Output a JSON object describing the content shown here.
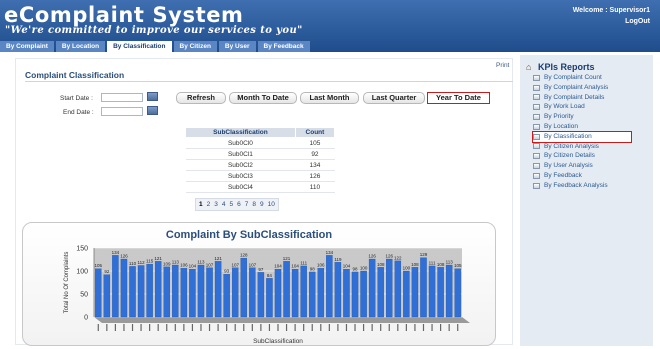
{
  "header": {
    "title": "eComplaint System",
    "tagline": "\"We're committed to improve our services to you\"",
    "welcome": "Welcome : Supervisor1",
    "logout": "LogOut",
    "tabs": [
      "By Complaint",
      "By Location",
      "By Classification",
      "By Citizen",
      "By User",
      "By Feedback"
    ],
    "active_tab": "By Classification"
  },
  "main": {
    "print": "Print",
    "section_title": "Complaint Classification",
    "start_date_label": "Start Date :",
    "end_date_label": "End Date :",
    "start_date_value": "",
    "end_date_value": "",
    "buttons": {
      "refresh": "Refresh",
      "month_to_date": "Month To Date",
      "last_month": "Last Month",
      "last_quarter": "Last Quarter",
      "year_to_date": "Year To Date"
    },
    "table": {
      "headers": [
        "SubClassification",
        "Count"
      ],
      "rows": [
        [
          "Sub0Cl0",
          "105"
        ],
        [
          "Sub0Cl1",
          "92"
        ],
        [
          "Sub0Cl2",
          "134"
        ],
        [
          "Sub0Cl3",
          "126"
        ],
        [
          "Sub0Cl4",
          "110"
        ]
      ]
    },
    "pager": [
      "1",
      "2",
      "3",
      "4",
      "5",
      "6",
      "7",
      "8",
      "9",
      "10"
    ],
    "pager_current": "1"
  },
  "chart_data": {
    "type": "bar",
    "title": "Complaint By SubClassification",
    "xlabel": "SubClassification",
    "ylabel": "Total No Of Complaints",
    "ylim": [
      0,
      150
    ],
    "yticks": [
      0,
      50,
      100,
      150
    ],
    "grid": true,
    "bar_color": "#2f6fd6",
    "values": [
      105,
      92,
      134,
      126,
      110,
      112,
      115,
      121,
      109,
      113,
      106,
      104,
      113,
      107,
      121,
      93,
      107,
      128,
      107,
      97,
      84,
      104,
      121,
      104,
      111,
      98,
      106,
      134,
      119,
      104,
      98,
      100,
      126,
      108,
      126,
      122,
      100,
      108,
      129,
      111,
      108,
      113,
      105
    ]
  },
  "sidebar": {
    "title": "KPIs Reports",
    "items": [
      "By Complaint Count",
      "By Complaint Analysis",
      "By Complaint Details",
      "By Work Load",
      "By Priority",
      "By Location",
      "By Classification",
      "By Citizen Analysis",
      "By Citizen Details",
      "By User Analysis",
      "By Feedback",
      "By Feedback Analysis"
    ],
    "active_item": "By Classification"
  },
  "colors": {
    "header_bg": "#2b5a9a",
    "accent_red": "#cc1a1a",
    "sidebar_bg": "#e5ebf3",
    "bar": "#2f6fd6"
  }
}
